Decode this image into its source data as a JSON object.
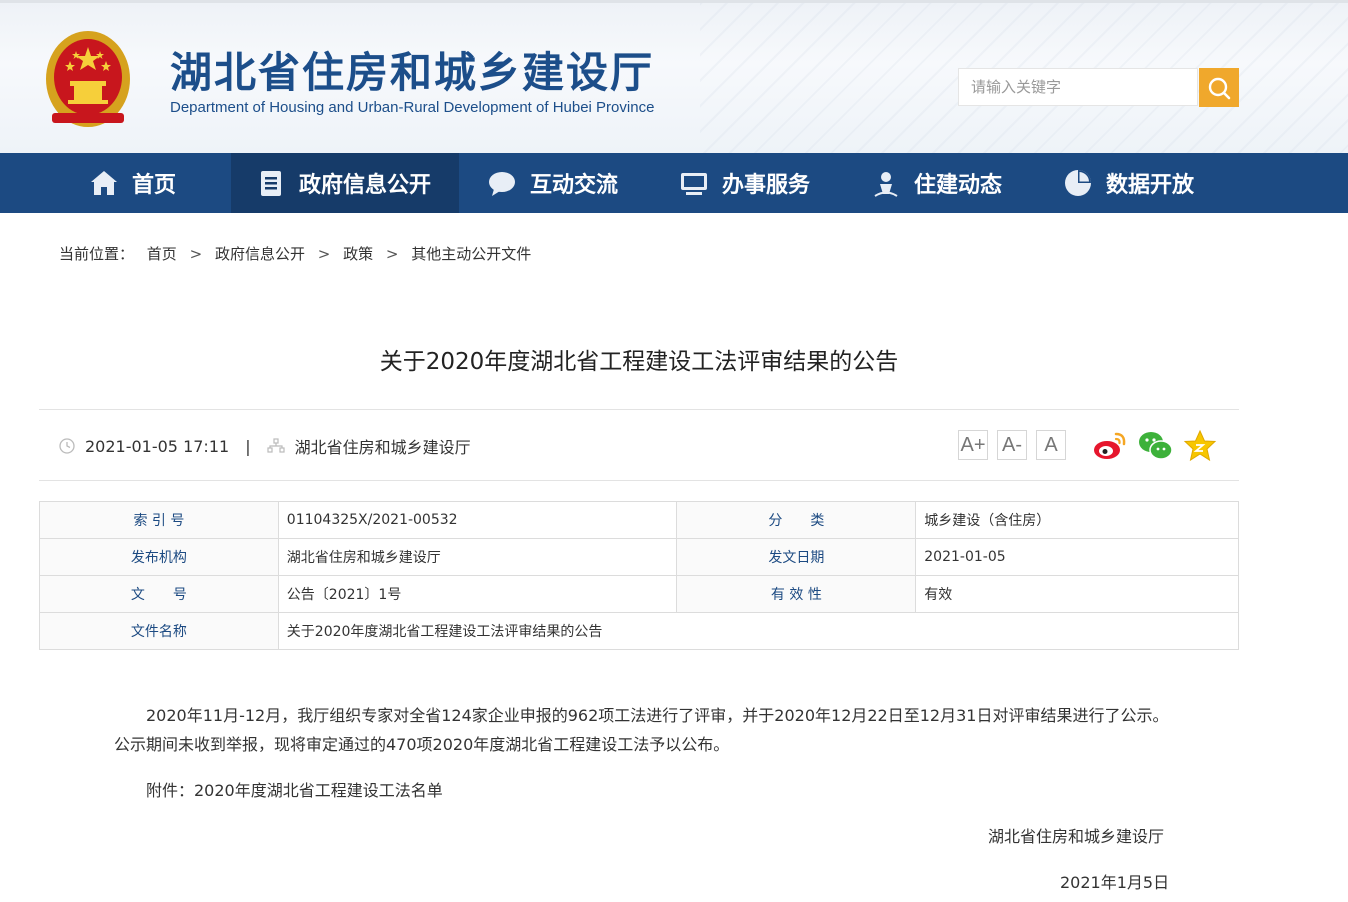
{
  "header": {
    "title": "湖北省住房和城乡建设厅",
    "subtitle": "Department of Housing and Urban-Rural Development of Hubei Province",
    "search_placeholder": "请输入关键字",
    "emblem_icon": "national-emblem-icon",
    "search_icon": "search-icon"
  },
  "nav": {
    "items": [
      {
        "label": "首页",
        "icon": "home-icon"
      },
      {
        "label": "政府信息公开",
        "icon": "document-icon"
      },
      {
        "label": "互动交流",
        "icon": "chat-bubble-icon"
      },
      {
        "label": "办事服务",
        "icon": "monitor-icon"
      },
      {
        "label": "住建动态",
        "icon": "person-pin-icon"
      },
      {
        "label": "数据开放",
        "icon": "pie-chart-icon"
      }
    ],
    "active_index": 1
  },
  "breadcrumb": {
    "prefix": "当前位置：",
    "items": [
      "首页",
      "政府信息公开",
      "政策",
      "其他主动公开文件"
    ],
    "separator": ">"
  },
  "article": {
    "title": "关于2020年度湖北省工程建设工法评审结果的公告",
    "datetime": "2021-01-05 17:11",
    "divider": "|",
    "source": "湖北省住房和城乡建设厅",
    "font_buttons": [
      "A+",
      "A-",
      "A"
    ],
    "share_icons": [
      "weibo-icon",
      "wechat-icon",
      "favorite-star-icon"
    ]
  },
  "info_table": {
    "rows": [
      {
        "k1": "索 引 号",
        "v1": "01104325X/2021-00532",
        "k2": "分　　类",
        "v2": "城乡建设（含住房）"
      },
      {
        "k1": "发布机构",
        "v1": "湖北省住房和城乡建设厅",
        "k2": "发文日期",
        "v2": "2021-01-05"
      },
      {
        "k1": "文　　号",
        "v1": "公告〔2021〕1号",
        "k2": "有 效 性",
        "v2": "有效"
      },
      {
        "k1": "文件名称",
        "v1": "关于2020年度湖北省工程建设工法评审结果的公告"
      }
    ]
  },
  "body": {
    "para1_line1": "2020年11月-12月，我厅组织专家对全省124家企业申报的962项工法进行了评审，并于2020年12月22日至12月31日对评审结果进行了公示。",
    "para1_line2": "公示期间未收到举报，现将审定通过的470项2020年度湖北省工程建设工法予以公布。",
    "attachment": "附件：2020年度湖北省工程建设工法名单",
    "signer": "湖北省住房和城乡建设厅",
    "sign_date": "2021年1月5日"
  },
  "colors": {
    "nav_bg": "#1c4a82",
    "nav_active_bg": "#163b69",
    "title_blue": "#1c4e8a",
    "search_btn": "#f0a82c"
  }
}
